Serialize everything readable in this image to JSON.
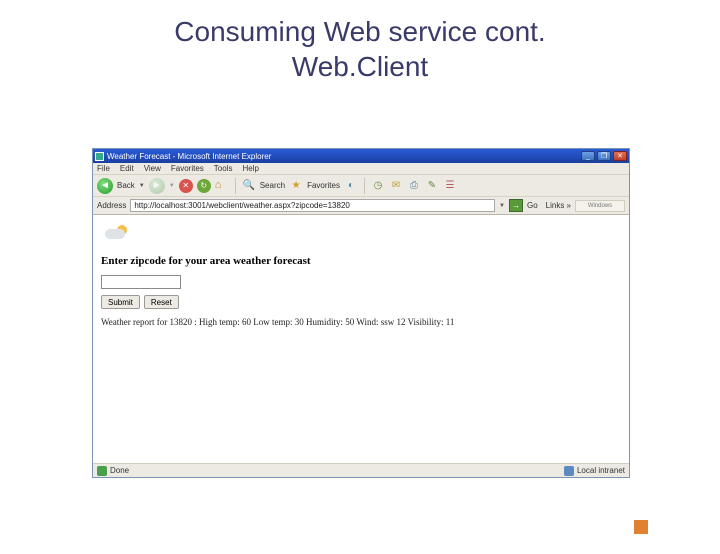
{
  "slide": {
    "title_line1": "Consuming Web service cont.",
    "title_line2": "Web.Client"
  },
  "browser": {
    "title": "Weather Forecast - Microsoft Internet Explorer",
    "menu": {
      "file": "File",
      "edit": "Edit",
      "view": "View",
      "favorites": "Favorites",
      "tools": "Tools",
      "help": "Help"
    },
    "toolbar": {
      "back": "Back",
      "search": "Search",
      "favorites": "Favorites"
    },
    "address_label": "Address",
    "address_value": "http://localhost:3001/webclient/weather.aspx?zipcode=13820",
    "go": "Go",
    "links_label": "Links »",
    "links_item": "Windows"
  },
  "page": {
    "heading": "Enter zipcode for your area weather forecast",
    "zip_value": "",
    "submit": "Submit",
    "reset": "Reset",
    "result": "Weather report for 13820 : High temp: 60 Low temp: 30 Humidity: 50 Wind: ssw 12 Visibility: 11"
  },
  "status": {
    "done": "Done",
    "zone": "Local intranet"
  },
  "win": {
    "min": "_",
    "max": "❐",
    "close": "✕"
  },
  "icons": {
    "back_arrow": "◄",
    "fwd_arrow": "►",
    "stop": "✕",
    "refresh": "↻",
    "home": "⌂",
    "search": "🔍",
    "star": "★",
    "go_arrow": "→"
  }
}
